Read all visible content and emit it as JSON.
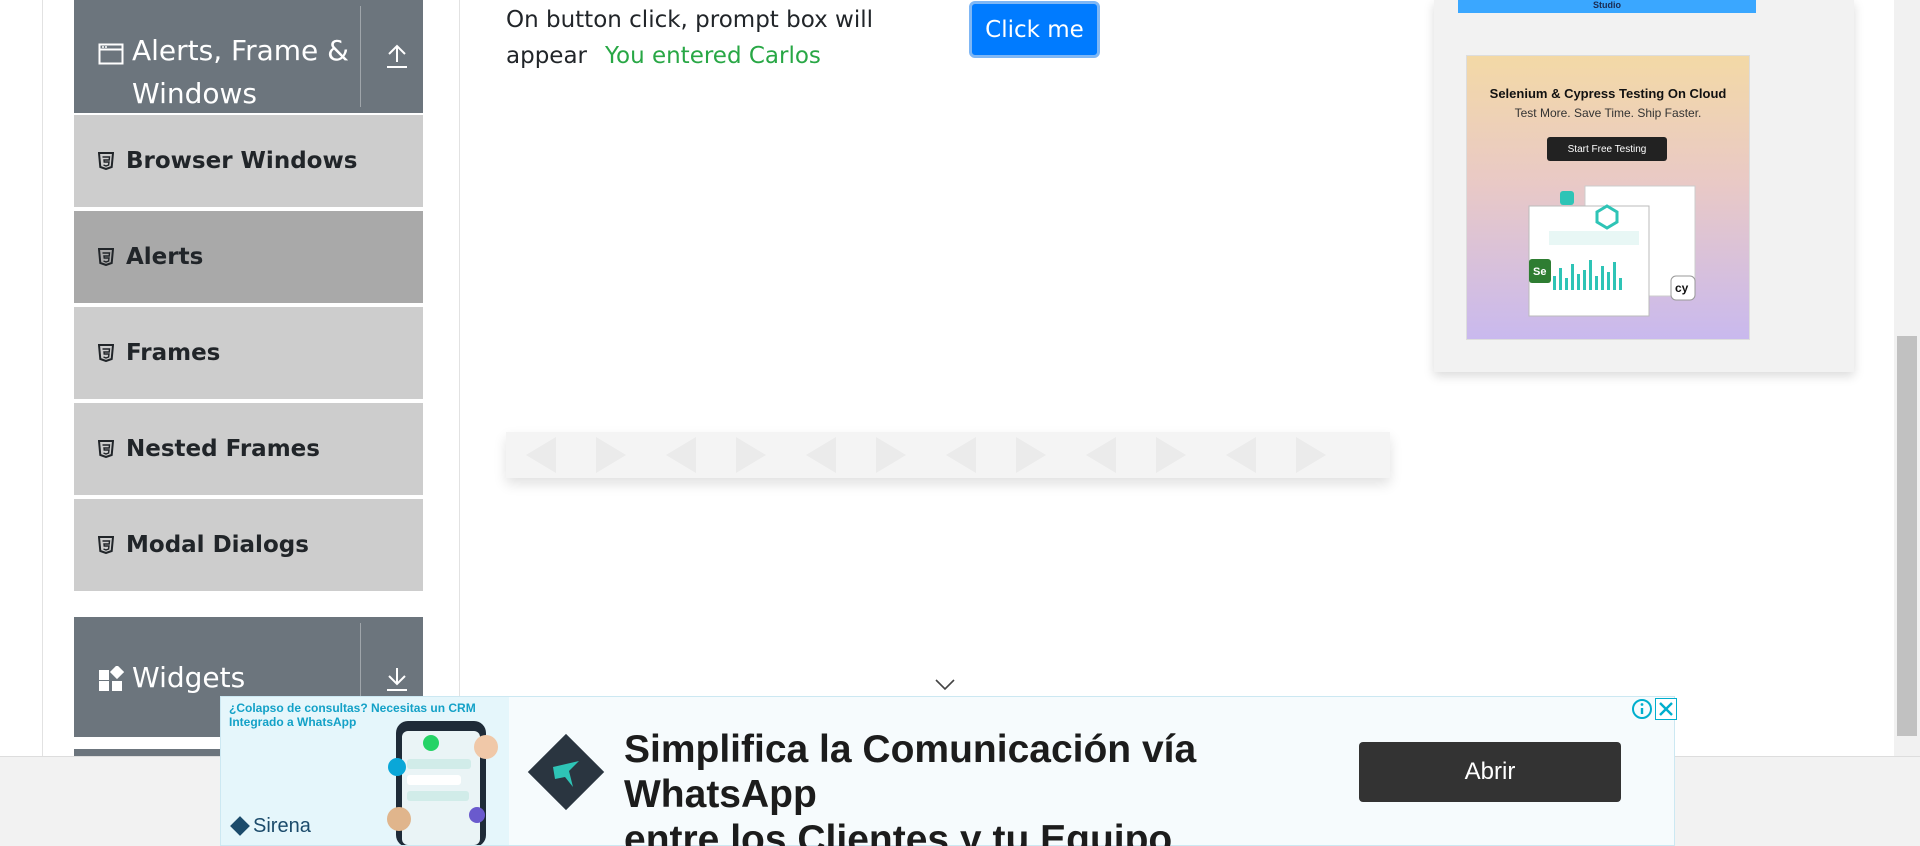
{
  "sidebar": {
    "alerts_group": {
      "title_line1": "Alerts, Frame &",
      "title_line2": "Windows"
    },
    "items": [
      {
        "label": "Browser Windows"
      },
      {
        "label": "Alerts"
      },
      {
        "label": "Frames"
      },
      {
        "label": "Nested Frames"
      },
      {
        "label": "Modal Dialogs"
      }
    ],
    "widgets_group": {
      "title": "Widgets"
    }
  },
  "main": {
    "prompt_line1": "On button click, prompt box will",
    "prompt_line2": "appear",
    "prompt_result": "You entered Carlos",
    "click_button_label": "Click me"
  },
  "right_ad": {
    "top_label": "Studio",
    "title": "Selenium & Cypress Testing On Cloud",
    "subtitle": "Test More. Save Time. Ship Faster.",
    "button_label": "Start Free Testing",
    "se_badge": "Se",
    "cy_badge": "cy"
  },
  "bottom_ad": {
    "headline_small": "¿Colapso de consultas? Necesitas un CRM Integrado a WhatsApp",
    "brand": "Sirena",
    "headline_line1": "Simplifica la Comunicación vía WhatsApp",
    "headline_line2": "entre los Clientes y tu Equipo.",
    "button_label": "Abrir"
  },
  "colors": {
    "sidebar_header": "#6c757d",
    "sidebar_item": "#cdcdcd",
    "sidebar_item_active": "#a9a9a9",
    "primary": "#007bff",
    "success": "#28a745"
  }
}
